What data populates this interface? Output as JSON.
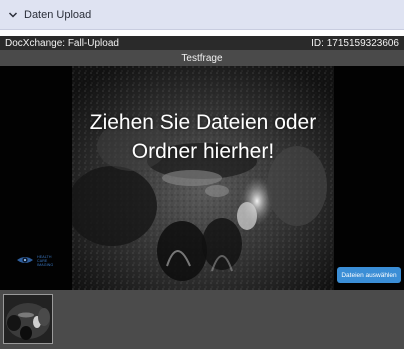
{
  "header": {
    "title": "Daten Upload",
    "toggle_icon": "chevron-down-icon"
  },
  "infobar": {
    "left_text": "DocXchange: Fall-Upload",
    "right_text": "ID: 1715159323606"
  },
  "titlebar": {
    "title": "Testfrage"
  },
  "dropzone": {
    "line1": "Ziehen Sie Dateien oder",
    "line2": "Ordner hierher!",
    "select_button_label": "Dateien auswählen",
    "logo_icon": "eye-logo-icon",
    "logo_text": [
      "HEALTH",
      "CARE",
      "IMAGING"
    ]
  },
  "thumbnails": [
    {
      "icon": "mri-thumbnail-icon"
    }
  ],
  "colors": {
    "topbar_bg": "#dfe3f2",
    "infobar_bg": "#2a2a2a",
    "titlebar_bg": "#4a4a4a",
    "thumbstrip_bg": "#4b4b4b",
    "button_bg": "#3b8ed6"
  }
}
